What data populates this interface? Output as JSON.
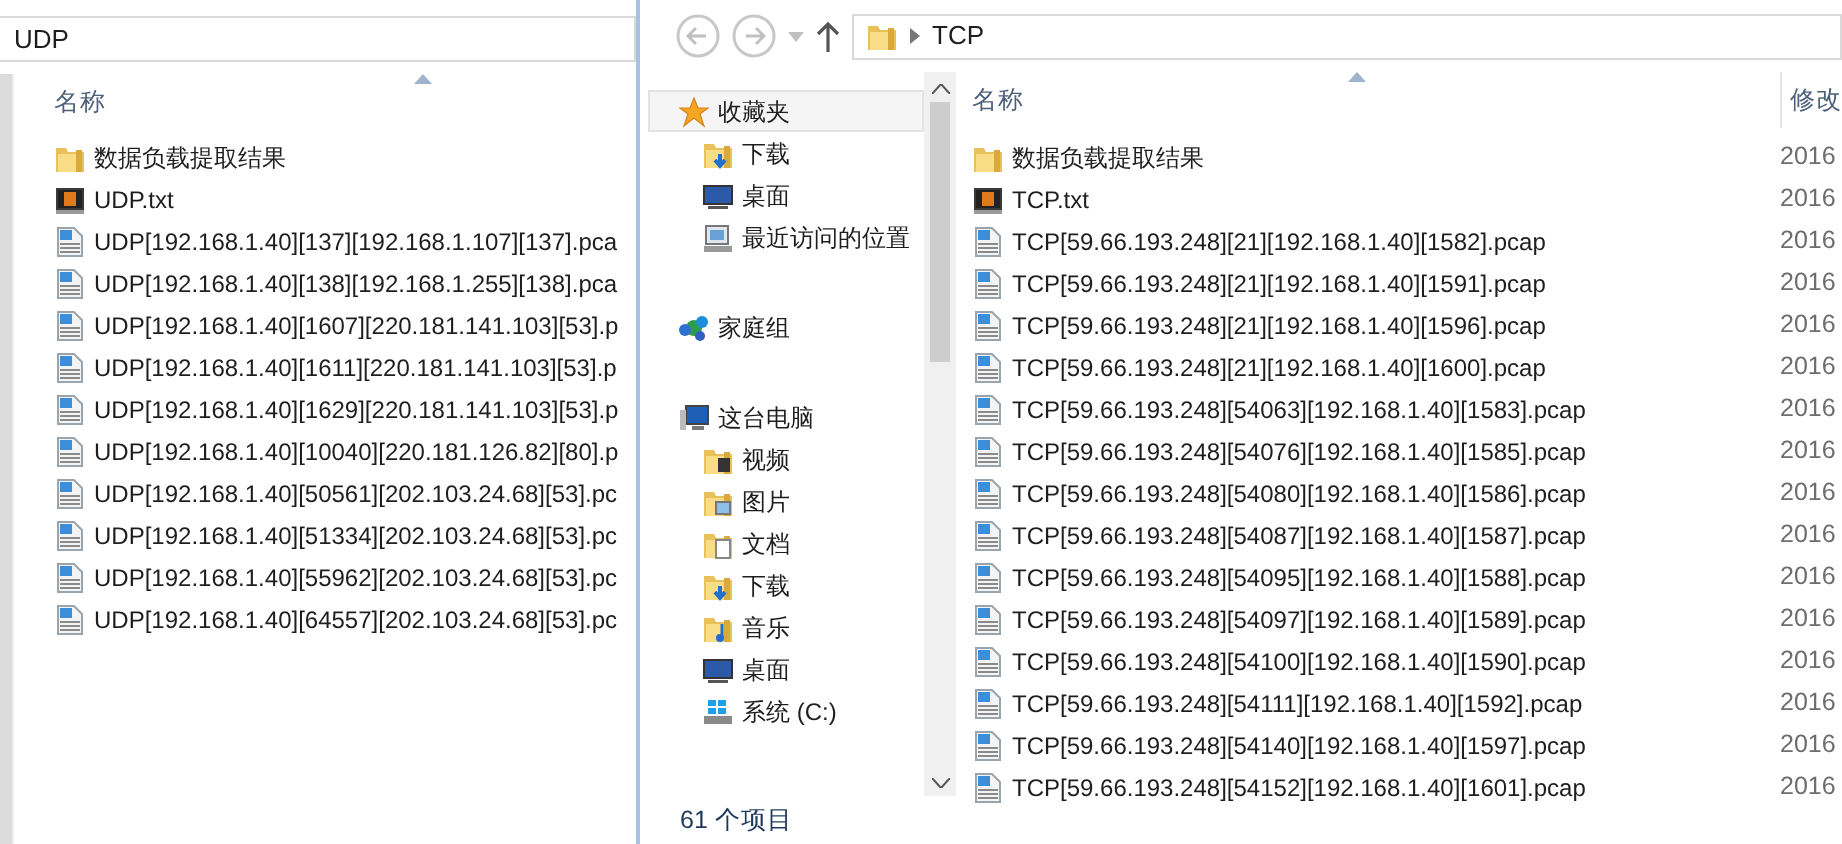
{
  "left_window": {
    "address": "UDP",
    "column_header": "名称",
    "files": [
      {
        "kind": "folder",
        "name": "数据负载提取结果"
      },
      {
        "kind": "text",
        "name": "UDP.txt"
      },
      {
        "kind": "pcap",
        "name": "UDP[192.168.1.40][137][192.168.1.107][137].pca"
      },
      {
        "kind": "pcap",
        "name": "UDP[192.168.1.40][138][192.168.1.255][138].pca"
      },
      {
        "kind": "pcap",
        "name": "UDP[192.168.1.40][1607][220.181.141.103][53].p"
      },
      {
        "kind": "pcap",
        "name": "UDP[192.168.1.40][1611][220.181.141.103][53].p"
      },
      {
        "kind": "pcap",
        "name": "UDP[192.168.1.40][1629][220.181.141.103][53].p"
      },
      {
        "kind": "pcap",
        "name": "UDP[192.168.1.40][10040][220.181.126.82][80].p"
      },
      {
        "kind": "pcap",
        "name": "UDP[192.168.1.40][50561][202.103.24.68][53].pc"
      },
      {
        "kind": "pcap",
        "name": "UDP[192.168.1.40][51334][202.103.24.68][53].pc"
      },
      {
        "kind": "pcap",
        "name": "UDP[192.168.1.40][55962][202.103.24.68][53].pc"
      },
      {
        "kind": "pcap",
        "name": "UDP[192.168.1.40][64557][202.103.24.68][53].pc"
      }
    ]
  },
  "right_window": {
    "address": "TCP",
    "nav_pane": [
      {
        "kind": "star",
        "label": "收藏夹",
        "selected": true,
        "children": [
          {
            "kind": "download",
            "label": "下载",
            "selected": false
          },
          {
            "kind": "desktop",
            "label": "桌面",
            "selected": false
          },
          {
            "kind": "recent",
            "label": "最近访问的位置",
            "selected": false
          }
        ]
      },
      {
        "kind": "homegroup",
        "label": "家庭组",
        "selected": false
      },
      {
        "kind": "computer",
        "label": "这台电脑",
        "selected": false,
        "children": [
          {
            "kind": "video",
            "label": "视频",
            "selected": false
          },
          {
            "kind": "pictures",
            "label": "图片",
            "selected": false
          },
          {
            "kind": "documents",
            "label": "文档",
            "selected": false
          },
          {
            "kind": "download",
            "label": "下载",
            "selected": false
          },
          {
            "kind": "music",
            "label": "音乐",
            "selected": false
          },
          {
            "kind": "desktop",
            "label": "桌面",
            "selected": false
          },
          {
            "kind": "drive",
            "label": "系统 (C:)",
            "selected": false
          }
        ]
      }
    ],
    "columns": [
      "名称",
      "修改"
    ],
    "files": [
      {
        "kind": "folder",
        "name": "数据负载提取结果",
        "date": "2016"
      },
      {
        "kind": "text",
        "name": "TCP.txt",
        "date": "2016"
      },
      {
        "kind": "pcap",
        "name": "TCP[59.66.193.248][21][192.168.1.40][1582].pcap",
        "date": "2016"
      },
      {
        "kind": "pcap",
        "name": "TCP[59.66.193.248][21][192.168.1.40][1591].pcap",
        "date": "2016"
      },
      {
        "kind": "pcap",
        "name": "TCP[59.66.193.248][21][192.168.1.40][1596].pcap",
        "date": "2016"
      },
      {
        "kind": "pcap",
        "name": "TCP[59.66.193.248][21][192.168.1.40][1600].pcap",
        "date": "2016"
      },
      {
        "kind": "pcap",
        "name": "TCP[59.66.193.248][54063][192.168.1.40][1583].pcap",
        "date": "2016"
      },
      {
        "kind": "pcap",
        "name": "TCP[59.66.193.248][54076][192.168.1.40][1585].pcap",
        "date": "2016"
      },
      {
        "kind": "pcap",
        "name": "TCP[59.66.193.248][54080][192.168.1.40][1586].pcap",
        "date": "2016"
      },
      {
        "kind": "pcap",
        "name": "TCP[59.66.193.248][54087][192.168.1.40][1587].pcap",
        "date": "2016"
      },
      {
        "kind": "pcap",
        "name": "TCP[59.66.193.248][54095][192.168.1.40][1588].pcap",
        "date": "2016"
      },
      {
        "kind": "pcap",
        "name": "TCP[59.66.193.248][54097][192.168.1.40][1589].pcap",
        "date": "2016"
      },
      {
        "kind": "pcap",
        "name": "TCP[59.66.193.248][54100][192.168.1.40][1590].pcap",
        "date": "2016"
      },
      {
        "kind": "pcap",
        "name": "TCP[59.66.193.248][54111][192.168.1.40][1592].pcap",
        "date": "2016"
      },
      {
        "kind": "pcap",
        "name": "TCP[59.66.193.248][54140][192.168.1.40][1597].pcap",
        "date": "2016"
      },
      {
        "kind": "pcap",
        "name": "TCP[59.66.193.248][54152][192.168.1.40][1601].pcap",
        "date": "2016"
      }
    ],
    "status_bar": "61 个项目"
  }
}
